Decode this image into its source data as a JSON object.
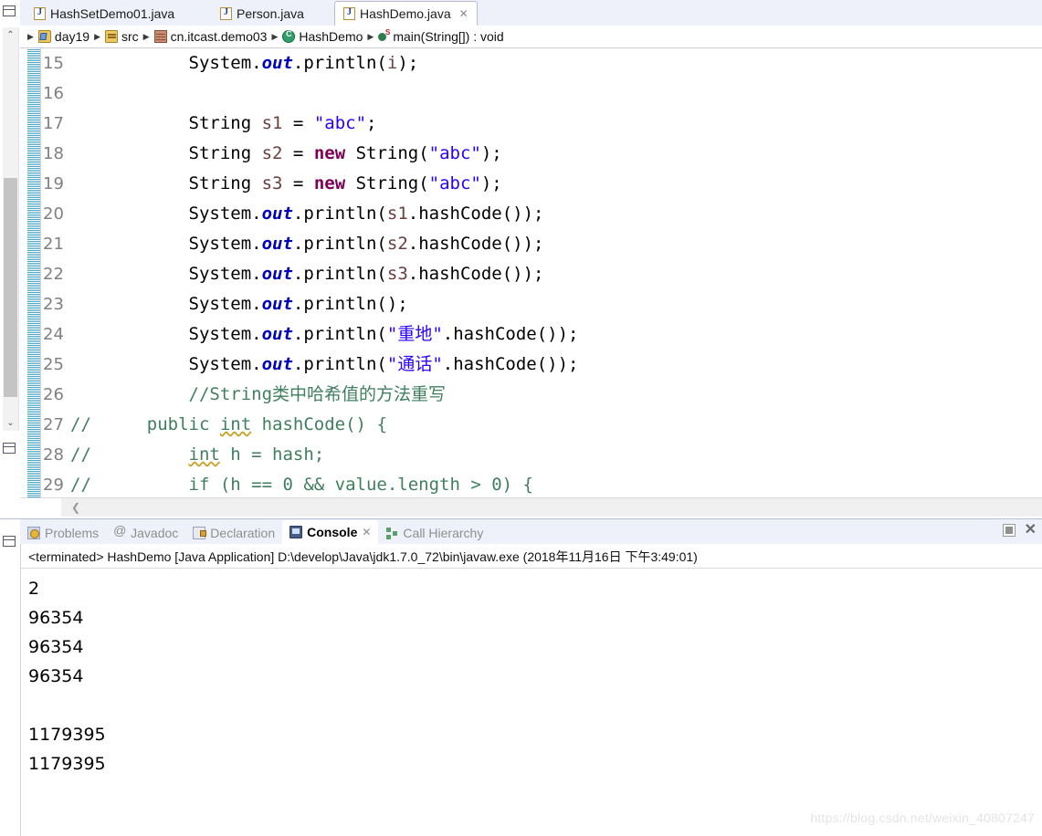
{
  "editor_tabs": [
    {
      "label": "HashSetDemo01.java",
      "icon": "java-file-icon",
      "active": false,
      "closable": false
    },
    {
      "label": "Person.java",
      "icon": "java-file-icon",
      "active": false,
      "closable": false
    },
    {
      "label": "HashDemo.java",
      "icon": "java-file-icon",
      "active": true,
      "closable": true,
      "close_glyph": "✕"
    }
  ],
  "breadcrumb": {
    "separator": "▶",
    "items": [
      {
        "label": "day19",
        "icon": "project-icon"
      },
      {
        "label": "src",
        "icon": "source-folder-icon"
      },
      {
        "label": "cn.itcast.demo03",
        "icon": "package-icon"
      },
      {
        "label": "HashDemo",
        "icon": "class-icon"
      },
      {
        "label": "main(String[]) : void",
        "icon": "method-icon"
      }
    ]
  },
  "code": {
    "lines": [
      {
        "num": "15",
        "cmt": "",
        "tokens": [
          {
            "t": "        ",
            "c": "plain"
          },
          {
            "t": "System.",
            "c": "plain"
          },
          {
            "t": "out",
            "c": "fld"
          },
          {
            "t": ".println(",
            "c": "plain"
          },
          {
            "t": "i",
            "c": "loc"
          },
          {
            "t": ");",
            "c": "plain"
          }
        ]
      },
      {
        "num": "16",
        "cmt": "",
        "tokens": []
      },
      {
        "num": "17",
        "cmt": "",
        "tokens": [
          {
            "t": "        String ",
            "c": "plain"
          },
          {
            "t": "s1",
            "c": "loc"
          },
          {
            "t": " = ",
            "c": "plain"
          },
          {
            "t": "\"abc\"",
            "c": "str"
          },
          {
            "t": ";",
            "c": "plain"
          }
        ]
      },
      {
        "num": "18",
        "cmt": "",
        "tokens": [
          {
            "t": "        String ",
            "c": "plain"
          },
          {
            "t": "s2",
            "c": "loc"
          },
          {
            "t": " = ",
            "c": "plain"
          },
          {
            "t": "new",
            "c": "kw"
          },
          {
            "t": " String(",
            "c": "plain"
          },
          {
            "t": "\"abc\"",
            "c": "str"
          },
          {
            "t": ");",
            "c": "plain"
          }
        ]
      },
      {
        "num": "19",
        "cmt": "",
        "tokens": [
          {
            "t": "        String ",
            "c": "plain"
          },
          {
            "t": "s3",
            "c": "loc"
          },
          {
            "t": " = ",
            "c": "plain"
          },
          {
            "t": "new",
            "c": "kw"
          },
          {
            "t": " String(",
            "c": "plain"
          },
          {
            "t": "\"abc\"",
            "c": "str"
          },
          {
            "t": ");",
            "c": "plain"
          }
        ]
      },
      {
        "num": "20",
        "cmt": "",
        "tokens": [
          {
            "t": "        System.",
            "c": "plain"
          },
          {
            "t": "out",
            "c": "fld"
          },
          {
            "t": ".println(",
            "c": "plain"
          },
          {
            "t": "s1",
            "c": "loc"
          },
          {
            "t": ".hashCode());",
            "c": "plain"
          }
        ]
      },
      {
        "num": "21",
        "cmt": "",
        "tokens": [
          {
            "t": "        System.",
            "c": "plain"
          },
          {
            "t": "out",
            "c": "fld"
          },
          {
            "t": ".println(",
            "c": "plain"
          },
          {
            "t": "s2",
            "c": "loc"
          },
          {
            "t": ".hashCode());",
            "c": "plain"
          }
        ]
      },
      {
        "num": "22",
        "cmt": "",
        "tokens": [
          {
            "t": "        System.",
            "c": "plain"
          },
          {
            "t": "out",
            "c": "fld"
          },
          {
            "t": ".println(",
            "c": "plain"
          },
          {
            "t": "s3",
            "c": "loc"
          },
          {
            "t": ".hashCode());",
            "c": "plain"
          }
        ]
      },
      {
        "num": "23",
        "cmt": "",
        "tokens": [
          {
            "t": "        System.",
            "c": "plain"
          },
          {
            "t": "out",
            "c": "fld"
          },
          {
            "t": ".println();",
            "c": "plain"
          }
        ]
      },
      {
        "num": "24",
        "cmt": "",
        "tokens": [
          {
            "t": "        System.",
            "c": "plain"
          },
          {
            "t": "out",
            "c": "fld"
          },
          {
            "t": ".println(",
            "c": "plain"
          },
          {
            "t": "\"重地\"",
            "c": "str"
          },
          {
            "t": ".hashCode());",
            "c": "plain"
          }
        ]
      },
      {
        "num": "25",
        "cmt": "",
        "tokens": [
          {
            "t": "        System.",
            "c": "plain"
          },
          {
            "t": "out",
            "c": "fld"
          },
          {
            "t": ".println(",
            "c": "plain"
          },
          {
            "t": "\"通话\"",
            "c": "str"
          },
          {
            "t": ".hashCode());",
            "c": "plain"
          }
        ]
      },
      {
        "num": "26",
        "cmt": "",
        "tokens": [
          {
            "t": "        //String类中哈希值的方法重写",
            "c": "cmt"
          }
        ]
      },
      {
        "num": "27",
        "cmt": "//",
        "tokens": [
          {
            "t": "    public ",
            "c": "cmt"
          },
          {
            "t": "int",
            "c": "cmt-u"
          },
          {
            "t": " hashCode() {",
            "c": "cmt"
          }
        ]
      },
      {
        "num": "28",
        "cmt": "//",
        "tokens": [
          {
            "t": "        ",
            "c": "cmt"
          },
          {
            "t": "int",
            "c": "cmt-u"
          },
          {
            "t": " h = hash;",
            "c": "cmt"
          }
        ]
      },
      {
        "num": "29",
        "cmt": "//",
        "tokens": [
          {
            "t": "        if (h == 0 && value.length > 0) {",
            "c": "cmt"
          }
        ]
      }
    ]
  },
  "view_tabs": [
    {
      "label": "Problems",
      "icon": "problems-icon",
      "active": false
    },
    {
      "label": "Javadoc",
      "icon": "javadoc-icon",
      "active": false
    },
    {
      "label": "Declaration",
      "icon": "declaration-icon",
      "active": false
    },
    {
      "label": "Console",
      "icon": "console-icon",
      "active": true,
      "close_glyph": "✕"
    },
    {
      "label": "Call Hierarchy",
      "icon": "call-hierarchy-icon",
      "active": false
    }
  ],
  "console": {
    "header": "<terminated> HashDemo [Java Application] D:\\develop\\Java\\jdk1.7.0_72\\bin\\javaw.exe (2018年11月16日 下午3:49:01)",
    "output": [
      "2",
      "96354",
      "96354",
      "96354",
      "",
      "1179395",
      "1179395"
    ]
  },
  "panel_tools": {
    "minimize_glyph": "",
    "close_glyph": "✕"
  },
  "scrollbars": {
    "up_arrow": "⌃",
    "down_arrow": "⌄",
    "left_arrow": "❮"
  },
  "watermark": "https://blog.csdn.net/weixin_40807247",
  "colors": {
    "keyword": "#7f0055",
    "string": "#2a00ff",
    "field": "#0000c0",
    "comment": "#3f7f5f",
    "local": "#6a3e3e",
    "tab_bar": "#eef1f9",
    "marker_bar": "#4aa8c4"
  }
}
